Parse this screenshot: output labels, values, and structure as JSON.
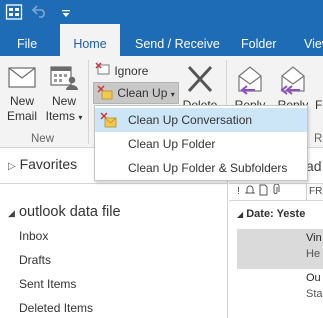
{
  "ribbon_tabs": [
    "File",
    "Home",
    "Send / Receive",
    "Folder",
    "View"
  ],
  "active_tab": "Home",
  "buttons": {
    "new_email": [
      "New",
      "Email"
    ],
    "new_items": [
      "New",
      "Items"
    ],
    "ignore": "Ignore",
    "clean_up": "Clean Up",
    "delete": "Delete",
    "reply": "Reply",
    "reply_all": "Reply",
    "forward": "F"
  },
  "groups": {
    "new": "New",
    "respond": "R"
  },
  "clean_up_menu": [
    "Clean Up Conversation",
    "Clean Up Folder",
    "Clean Up Folder & Subfolders"
  ],
  "folder_pane": {
    "favorites": "Favorites",
    "data_file": "outlook data file",
    "folders": [
      "Inbox",
      "Drafts",
      "Sent Items",
      "Deleted Items"
    ]
  },
  "message_pane": {
    "header_partial": "ad",
    "column_partial": "FR",
    "date_group": "Date: Yeste",
    "messages": [
      {
        "line1": "Vin",
        "line2": "He"
      },
      {
        "line1": "Ou",
        "line2": "Sta"
      }
    ]
  },
  "colors": {
    "accent": "#1e6cb6",
    "menu_highlight": "#cde6f7",
    "selected_row": "#dadada"
  }
}
